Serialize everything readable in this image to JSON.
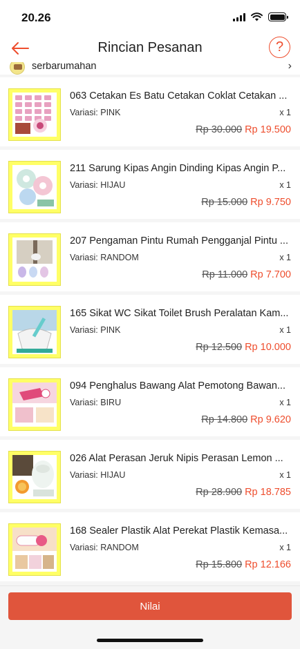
{
  "status": {
    "time": "20.26"
  },
  "nav": {
    "title": "Rincian Pesanan",
    "help": "?"
  },
  "shop": {
    "name": "serbarumahan"
  },
  "items": [
    {
      "title": "063 Cetakan Es Batu Cetakan Coklat Cetakan ...",
      "variant": "Variasi: PINK",
      "qty": "x 1",
      "old_price": "Rp 30.000",
      "new_price": "Rp 19.500",
      "thumb": "ice-mold"
    },
    {
      "title": "211 Sarung Kipas Angin Dinding Kipas Angin P...",
      "variant": "Variasi: HIJAU",
      "qty": "x 1",
      "old_price": "Rp 15.000",
      "new_price": "Rp 9.750",
      "thumb": "fan-cover"
    },
    {
      "title": "207 Pengaman Pintu Rumah Pengganjal Pintu ...",
      "variant": "Variasi: RANDOM",
      "qty": "x 1",
      "old_price": "Rp 11.000",
      "new_price": "Rp 7.700",
      "thumb": "door-stopper"
    },
    {
      "title": "165 Sikat WC Sikat Toilet Brush Peralatan Kam...",
      "variant": "Variasi: PINK",
      "qty": "x 1",
      "old_price": "Rp 12.500",
      "new_price": "Rp 10.000",
      "thumb": "toilet-brush"
    },
    {
      "title": "094 Penghalus Bawang Alat Pemotong Bawan...",
      "variant": "Variasi: BIRU",
      "qty": "x 1",
      "old_price": "Rp 14.800",
      "new_price": "Rp 9.620",
      "thumb": "garlic-press"
    },
    {
      "title": "026 Alat Perasan Jeruk Nipis Perasan Lemon ...",
      "variant": "Variasi: HIJAU",
      "qty": "x 1",
      "old_price": "Rp 28.900",
      "new_price": "Rp 18.785",
      "thumb": "lemon-squeezer"
    },
    {
      "title": "168 Sealer Plastik Alat Perekat Plastik Kemasa...",
      "variant": "Variasi: RANDOM",
      "qty": "x 1",
      "old_price": "Rp 15.800",
      "new_price": "Rp 12.166",
      "thumb": "bag-sealer"
    }
  ],
  "actions": {
    "rate_label": "Nilai"
  },
  "colors": {
    "accent": "#ee4d2d",
    "button": "#e0553c",
    "thumb_bg": "#ffff66"
  }
}
